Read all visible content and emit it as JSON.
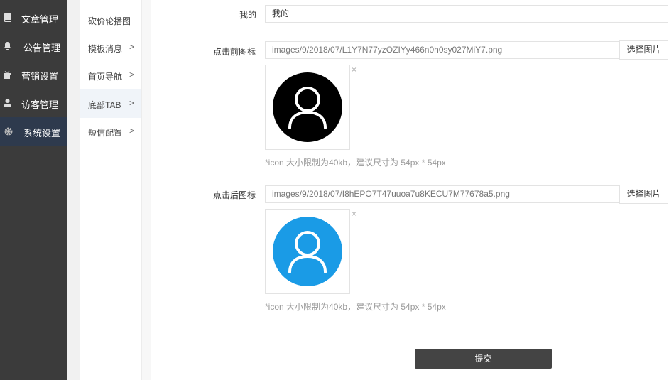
{
  "sidebar": {
    "items": [
      {
        "label": "文章管理",
        "icon": "book-icon"
      },
      {
        "label": "公告管理",
        "icon": "bell-icon"
      },
      {
        "label": "营销设置",
        "icon": "gift-icon"
      },
      {
        "label": "访客管理",
        "icon": "user-icon"
      },
      {
        "label": "系统设置",
        "icon": "gear-icon"
      }
    ]
  },
  "submenu": {
    "items": [
      {
        "label": "砍价轮播图",
        "arrow": ""
      },
      {
        "label": "模板消息",
        "arrow": ">"
      },
      {
        "label": "首页导航",
        "arrow": ">"
      },
      {
        "label": "底部TAB",
        "arrow": ">"
      },
      {
        "label": "短信配置",
        "arrow": ">"
      }
    ]
  },
  "form": {
    "name": {
      "label": "我的",
      "value": "我的"
    },
    "icon_before": {
      "label": "点击前图标",
      "value": "images/9/2018/07/L1Y7N77yzOZIYy466n0h0sy027MiY7.png",
      "button": "选择图片",
      "remove": "×",
      "hint": "*icon 大小限制为40kb，建议尺寸为 54px * 54px",
      "color": "#000000"
    },
    "icon_after": {
      "label": "点击后图标",
      "value": "images/9/2018/07/I8hEPO7T47uuoa7u8KECU7M77678a5.png",
      "button": "选择图片",
      "remove": "×",
      "hint": "*icon 大小限制为40kb，建议尺寸为 54px * 54px",
      "color": "#1a9be6"
    },
    "submit": "提交"
  },
  "colors": {
    "sidebar_bg": "#3b3b3b",
    "sidebar_active": "#2e3a4d",
    "submit_bg": "#444444"
  }
}
